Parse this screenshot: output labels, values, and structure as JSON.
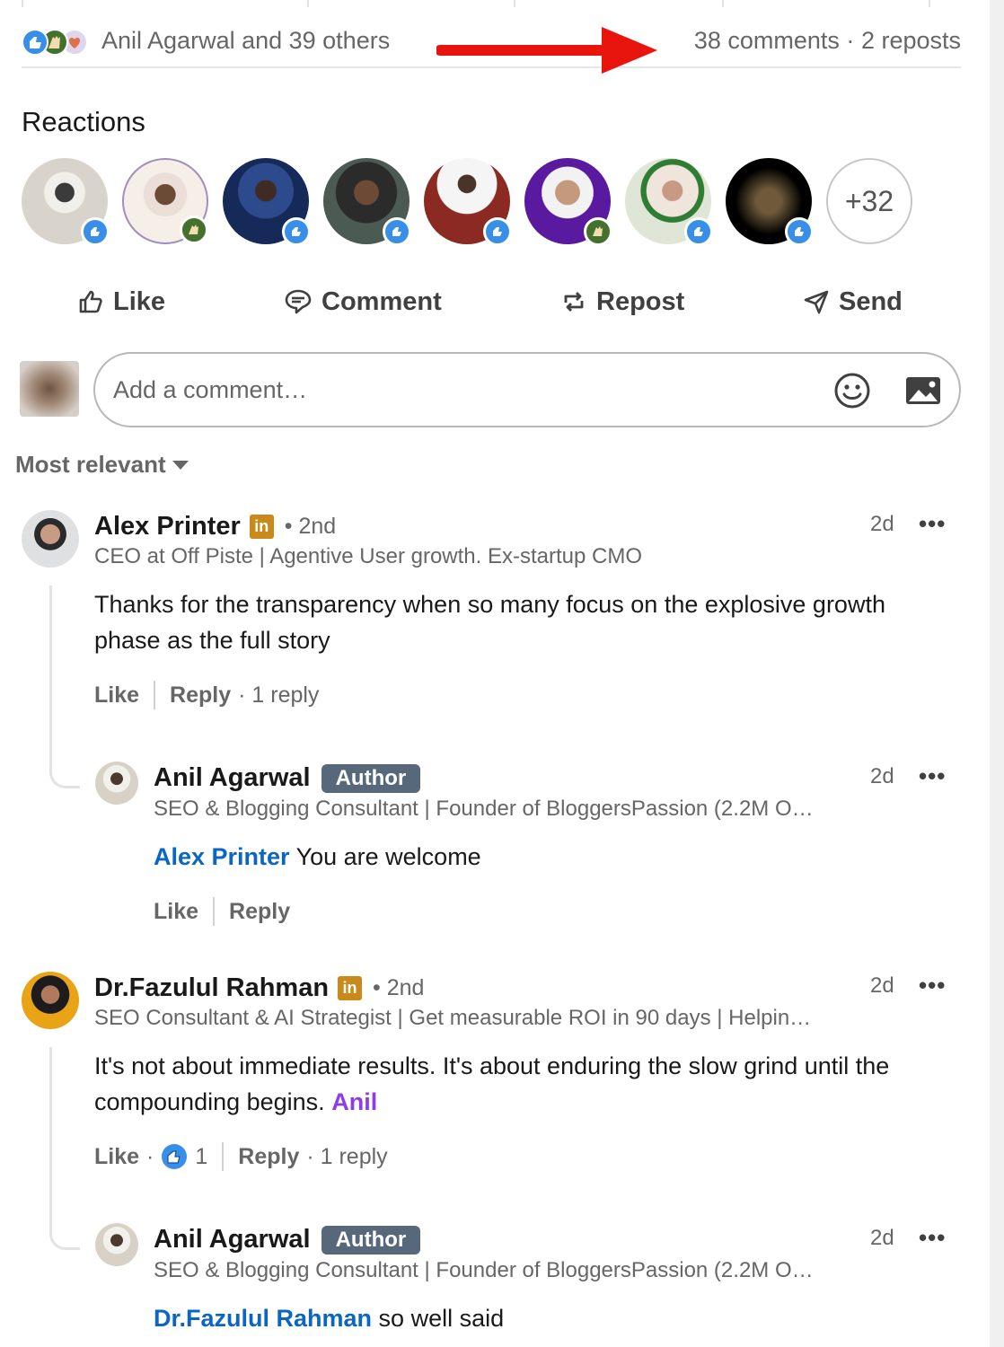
{
  "counts": {
    "reactors_text": "Anil Agarwal and 39 others",
    "comments_text": "38 comments",
    "separator": "·",
    "reposts_text": "2 reposts"
  },
  "reactions": {
    "heading": "Reactions",
    "more_count": "+32"
  },
  "actions": {
    "like": "Like",
    "comment": "Comment",
    "repost": "Repost",
    "send": "Send"
  },
  "comment_input": {
    "placeholder": "Add a comment…"
  },
  "sort": {
    "label": "Most relevant"
  },
  "comments": [
    {
      "name": "Alex Printer",
      "degree": "• 2nd",
      "headline": "CEO at Off Piste | Agentive User growth. Ex-startup CMO",
      "time": "2d",
      "more": "•••",
      "text": "Thanks for the transparency when so many focus on the explosive growth phase as the full story",
      "like": "Like",
      "reply": "Reply",
      "replies": "· 1 reply",
      "reply_item": {
        "name": "Anil Agarwal",
        "badge": "Author",
        "headline": "SEO & Blogging Consultant | Founder of BloggersPassion (2.2M O…",
        "time": "2d",
        "more": "•••",
        "mention": "Alex Printer",
        "text": " You are welcome",
        "like": "Like",
        "reply": "Reply"
      }
    },
    {
      "name": "Dr.Fazulul Rahman",
      "degree": "• 2nd",
      "headline": "SEO Consultant & AI Strategist | Get measurable ROI in 90 days | Helpin…",
      "time": "2d",
      "more": "•••",
      "text": "It's not about immediate results. It's about enduring the slow grind until the compounding begins.",
      "tag": "Anil",
      "like": "Like",
      "like_dot": "·",
      "like_count": "1",
      "reply": "Reply",
      "replies": "· 1 reply",
      "reply_item": {
        "name": "Anil Agarwal",
        "badge": "Author",
        "headline": "SEO & Blogging Consultant | Founder of BloggersPassion (2.2M O…",
        "time": "2d",
        "more": "•••",
        "mention": "Dr.Fazulul Rahman",
        "text": " so well said"
      }
    }
  ],
  "colors": {
    "link_blue": "#0a66c2",
    "author_badge": "#56687a",
    "like_blue": "#378fe9",
    "celebrate_green": "#44712e",
    "arrow_red": "#e8140e"
  },
  "icons": [
    "like-icon",
    "comment-icon",
    "repost-icon",
    "send-icon",
    "emoji-icon",
    "image-icon",
    "caret-down-icon",
    "linkedin-icon"
  ]
}
